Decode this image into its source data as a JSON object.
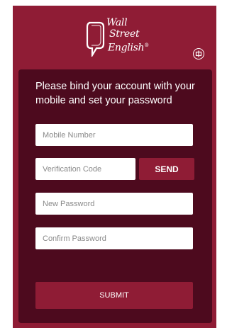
{
  "brand": {
    "lines": [
      "Wall",
      "Street",
      "English"
    ],
    "registered_mark": "®"
  },
  "header": {
    "language_icon": "globe-icon"
  },
  "form": {
    "headline": "Please bind your account with your mobile and set your password",
    "mobile_placeholder": "Mobile Number",
    "code_placeholder": "Verification Code",
    "send_label": "SEND",
    "new_password_placeholder": "New Password",
    "confirm_password_placeholder": "Confirm Password",
    "submit_label": "SUBMIT"
  },
  "colors": {
    "primary": "#8f1c35",
    "card": "#4d0a1e",
    "field": "#ffffff"
  }
}
